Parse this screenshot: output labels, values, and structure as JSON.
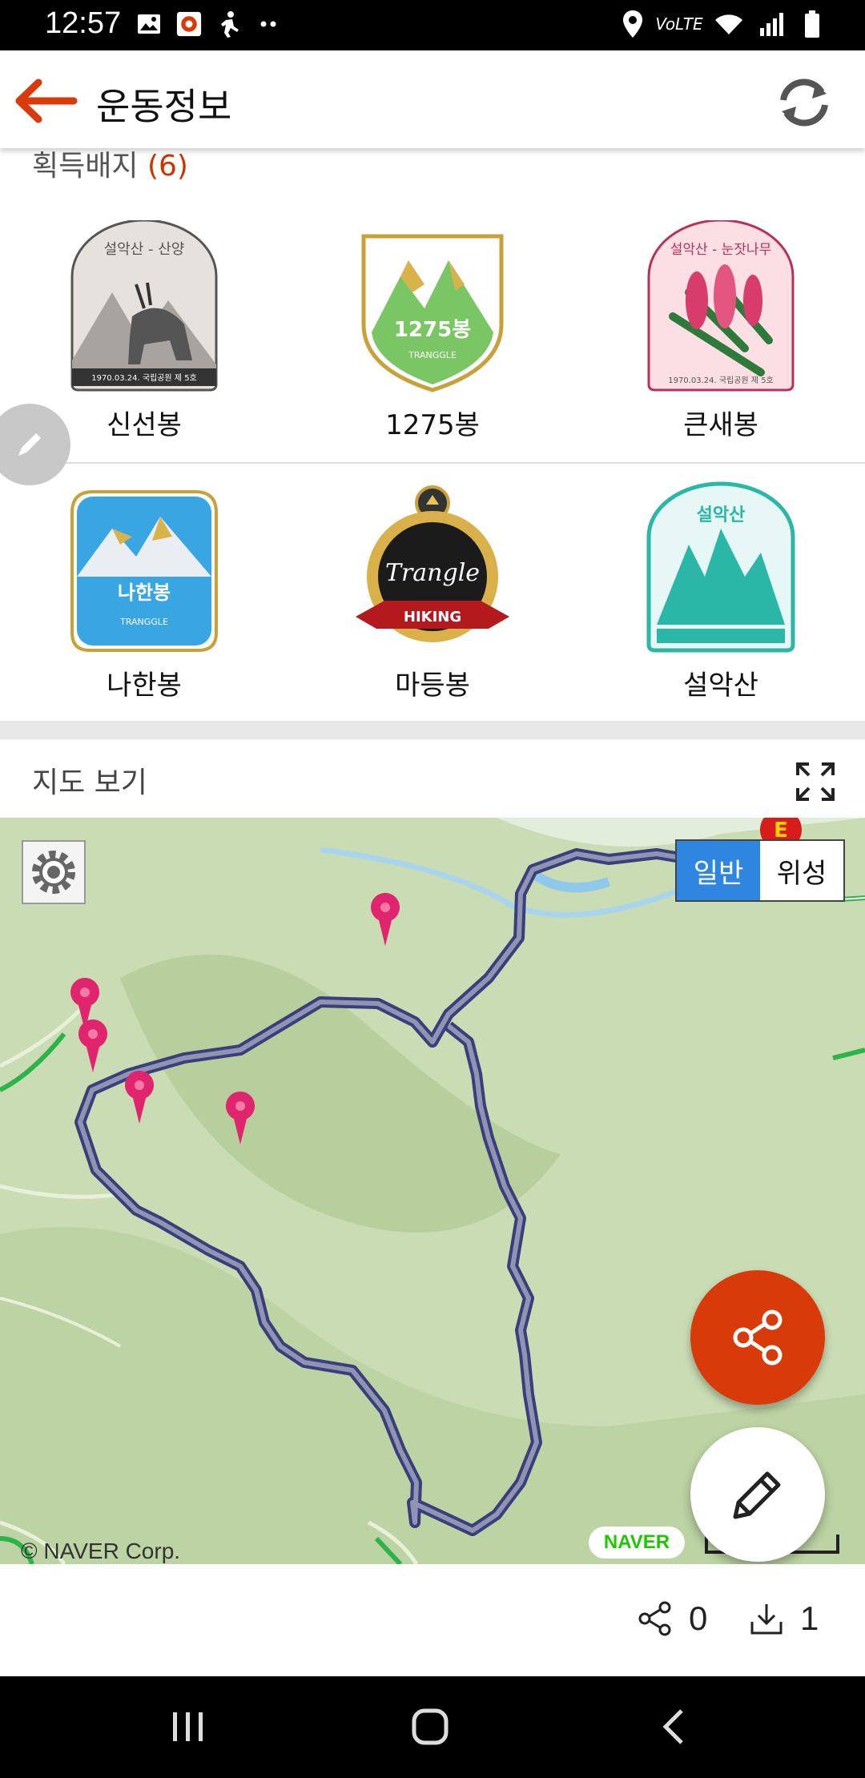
{
  "status_bar": {
    "time": "12:57",
    "left_icons": [
      "image-icon",
      "app-notification-icon",
      "walk-icon",
      "more-dots-icon"
    ],
    "right_icons": [
      "location-icon",
      "volte-lte-icon",
      "wifi-icon",
      "signal-icon",
      "battery-icon"
    ],
    "network_label": "VoLTE"
  },
  "app_bar": {
    "title": "운동정보",
    "back_icon": "back-arrow-icon",
    "refresh_icon": "refresh-icon"
  },
  "badges": {
    "section_label": "획득배지",
    "count": "(6)",
    "items": [
      {
        "label": "신선봉",
        "badge_text": "설악산 - 산양",
        "sub_text": "1970.03.24. 국립공원 제 5호"
      },
      {
        "label": "1275봉",
        "badge_text": "1275봉",
        "sub_text": "TRANGGLE"
      },
      {
        "label": "큰새봉",
        "badge_text": "설악산 - 눈잣나무",
        "sub_text": "1970.03.24. 국립공원 제 5호"
      },
      {
        "label": "나한봉",
        "badge_text": "나한봉",
        "sub_text": "TRANGGLE"
      },
      {
        "label": "마등봉",
        "badge_text": "Trangle",
        "sub_text": "HIKING"
      },
      {
        "label": "설악산",
        "badge_text": "설악산",
        "sub_text": ""
      }
    ]
  },
  "map_section": {
    "title": "지도 보기",
    "expand_icon": "expand-icon",
    "settings_icon": "gear-icon",
    "type_options": [
      "일반",
      "위성"
    ],
    "selected_type": "일반",
    "copyright": "© NAVER Corp.",
    "provider": "NAVER"
  },
  "actions": {
    "share_icon": "share-icon",
    "edit_icon": "pencil-icon"
  },
  "stats": {
    "share_count": "0",
    "download_count": "1"
  },
  "colors": {
    "accent": "#d83a0a",
    "map_type_active": "#2f86e0",
    "route": "#4a4f7a",
    "pin": "#e0246e"
  }
}
